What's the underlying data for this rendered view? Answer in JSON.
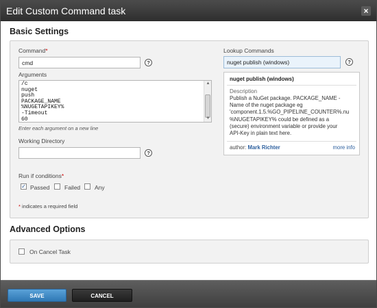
{
  "window": {
    "title": "Edit Custom Command task",
    "close_symbol": "×"
  },
  "basic": {
    "title": "Basic Settings",
    "command_label": "Command",
    "required_mark": "*",
    "command_value": "cmd",
    "help_symbol": "?",
    "arguments_label": "Arguments",
    "arguments_value": "/c\nnuget\npush\nPACKAGE_NAME\n%NUGETAPIKEY%\n-Timeout\n60",
    "arguments_hint": "Enter each argument on a new line",
    "working_dir_label": "Working Directory",
    "working_dir_value": "",
    "run_if_label": "Run if conditions",
    "run_if": [
      {
        "label": "Passed",
        "checked": true
      },
      {
        "label": "Failed",
        "checked": false
      },
      {
        "label": "Any",
        "checked": false
      }
    ],
    "required_note": "indicates a required field"
  },
  "lookup": {
    "label": "Lookup Commands",
    "value": "nuget publish (windows)",
    "card": {
      "title": "nuget publish (windows)",
      "description_label": "Description",
      "description": "Publish a NuGet package. PACKAGE_NAME -\nName of the nuget package eg\n'component.1.5.%GO_PIPELINE_COUNTER%.nu\n%NUGETAPIKEY% could be defined as a\n(secure) environment variable or provide your\nAPI-Key in plain text here.",
      "author_label": "author:",
      "author": "Mark Richter",
      "more_info": "more info"
    }
  },
  "advanced": {
    "title": "Advanced Options",
    "on_cancel_label": "On Cancel Task",
    "on_cancel_checked": false
  },
  "footer": {
    "save": "SAVE",
    "cancel": "CANCEL"
  },
  "colors": {
    "save_button": "#2f78b5",
    "titlebar": "#3a3a3a",
    "required": "#cc0000"
  }
}
